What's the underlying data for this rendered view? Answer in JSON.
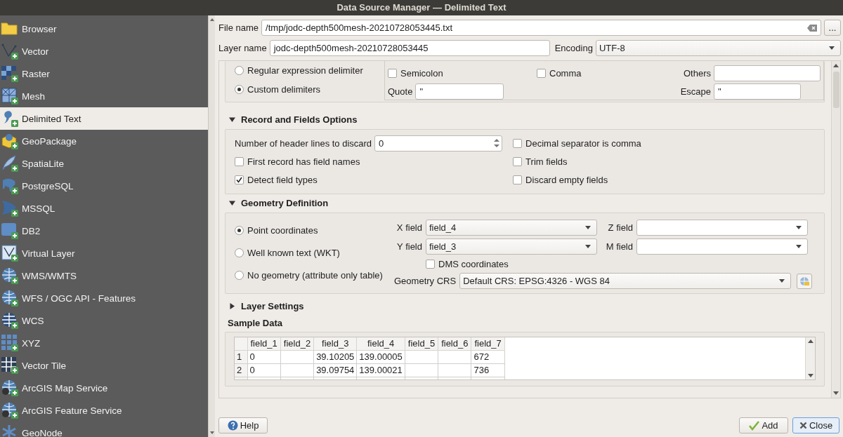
{
  "window": {
    "title": "Data Source Manager — Delimited Text"
  },
  "sidebar": {
    "items": [
      {
        "label": "Browser",
        "selected": false
      },
      {
        "label": "Vector",
        "selected": false
      },
      {
        "label": "Raster",
        "selected": false
      },
      {
        "label": "Mesh",
        "selected": false
      },
      {
        "label": "Delimited Text",
        "selected": true
      },
      {
        "label": "GeoPackage",
        "selected": false
      },
      {
        "label": "SpatiaLite",
        "selected": false
      },
      {
        "label": "PostgreSQL",
        "selected": false
      },
      {
        "label": "MSSQL",
        "selected": false
      },
      {
        "label": "DB2",
        "selected": false
      },
      {
        "label": "Virtual Layer",
        "selected": false
      },
      {
        "label": "WMS/WMTS",
        "selected": false
      },
      {
        "label": "WFS / OGC API - Features",
        "selected": false
      },
      {
        "label": "WCS",
        "selected": false
      },
      {
        "label": "XYZ",
        "selected": false
      },
      {
        "label": "Vector Tile",
        "selected": false
      },
      {
        "label": "ArcGIS Map Service",
        "selected": false
      },
      {
        "label": "ArcGIS Feature Service",
        "selected": false
      },
      {
        "label": "GeoNode",
        "selected": false
      }
    ]
  },
  "file": {
    "label": "File name",
    "value": "/tmp/jodc-depth500mesh-20210728053445.txt",
    "browse": "..."
  },
  "layer_name": {
    "label": "Layer name",
    "value": "jodc-depth500mesh-20210728053445"
  },
  "encoding": {
    "label": "Encoding",
    "value": "UTF-8"
  },
  "file_format": {
    "options": [
      {
        "label": "Regular expression delimiter",
        "selected": false
      },
      {
        "label": "Custom delimiters",
        "selected": true
      }
    ],
    "delimiters": [
      {
        "label": "Semicolon",
        "checked": false
      },
      {
        "label": "Comma",
        "checked": false
      }
    ],
    "others": {
      "label": "Others"
    },
    "quote": {
      "label": "Quote",
      "value": "\""
    },
    "escape": {
      "label": "Escape",
      "value": "\""
    }
  },
  "record_fields": {
    "title": "Record and Fields Options",
    "expanded": true,
    "header_lines": {
      "label": "Number of header lines to discard",
      "value": "0"
    },
    "left_options": [
      {
        "label": "First record has field names",
        "checked": false
      },
      {
        "label": "Detect field types",
        "checked": true
      }
    ],
    "right_options": [
      {
        "label": "Decimal separator is comma",
        "checked": false
      },
      {
        "label": "Trim fields",
        "checked": false
      },
      {
        "label": "Discard empty fields",
        "checked": false
      }
    ]
  },
  "geometry": {
    "title": "Geometry Definition",
    "expanded": true,
    "types": [
      {
        "label": "Point coordinates",
        "selected": true
      },
      {
        "label": "Well known text (WKT)",
        "selected": false
      },
      {
        "label": "No geometry (attribute only table)",
        "selected": false
      }
    ],
    "x_field": {
      "label": "X field",
      "value": "field_4"
    },
    "z_field": {
      "label": "Z field"
    },
    "y_field": {
      "label": "Y field",
      "value": "field_3"
    },
    "m_field": {
      "label": "M field"
    },
    "dms": {
      "label": "DMS coordinates",
      "checked": false
    },
    "crs": {
      "label": "Geometry CRS",
      "value": "Default CRS: EPSG:4326 - WGS 84"
    }
  },
  "layer_settings": {
    "title": "Layer Settings",
    "expanded": false
  },
  "sample_data": {
    "title": "Sample Data",
    "columns": [
      "field_1",
      "field_2",
      "field_3",
      "field_4",
      "field_5",
      "field_6",
      "field_7"
    ],
    "rows": [
      {
        "number": "1",
        "cells": [
          "0",
          null,
          "39.10205",
          "139.00005",
          null,
          null,
          "672"
        ]
      },
      {
        "number": "2",
        "cells": [
          "0",
          null,
          "39.09754",
          "139.00021",
          null,
          null,
          "736"
        ]
      }
    ]
  },
  "buttons": {
    "help": "Help",
    "add": "Add",
    "close": "Close"
  }
}
